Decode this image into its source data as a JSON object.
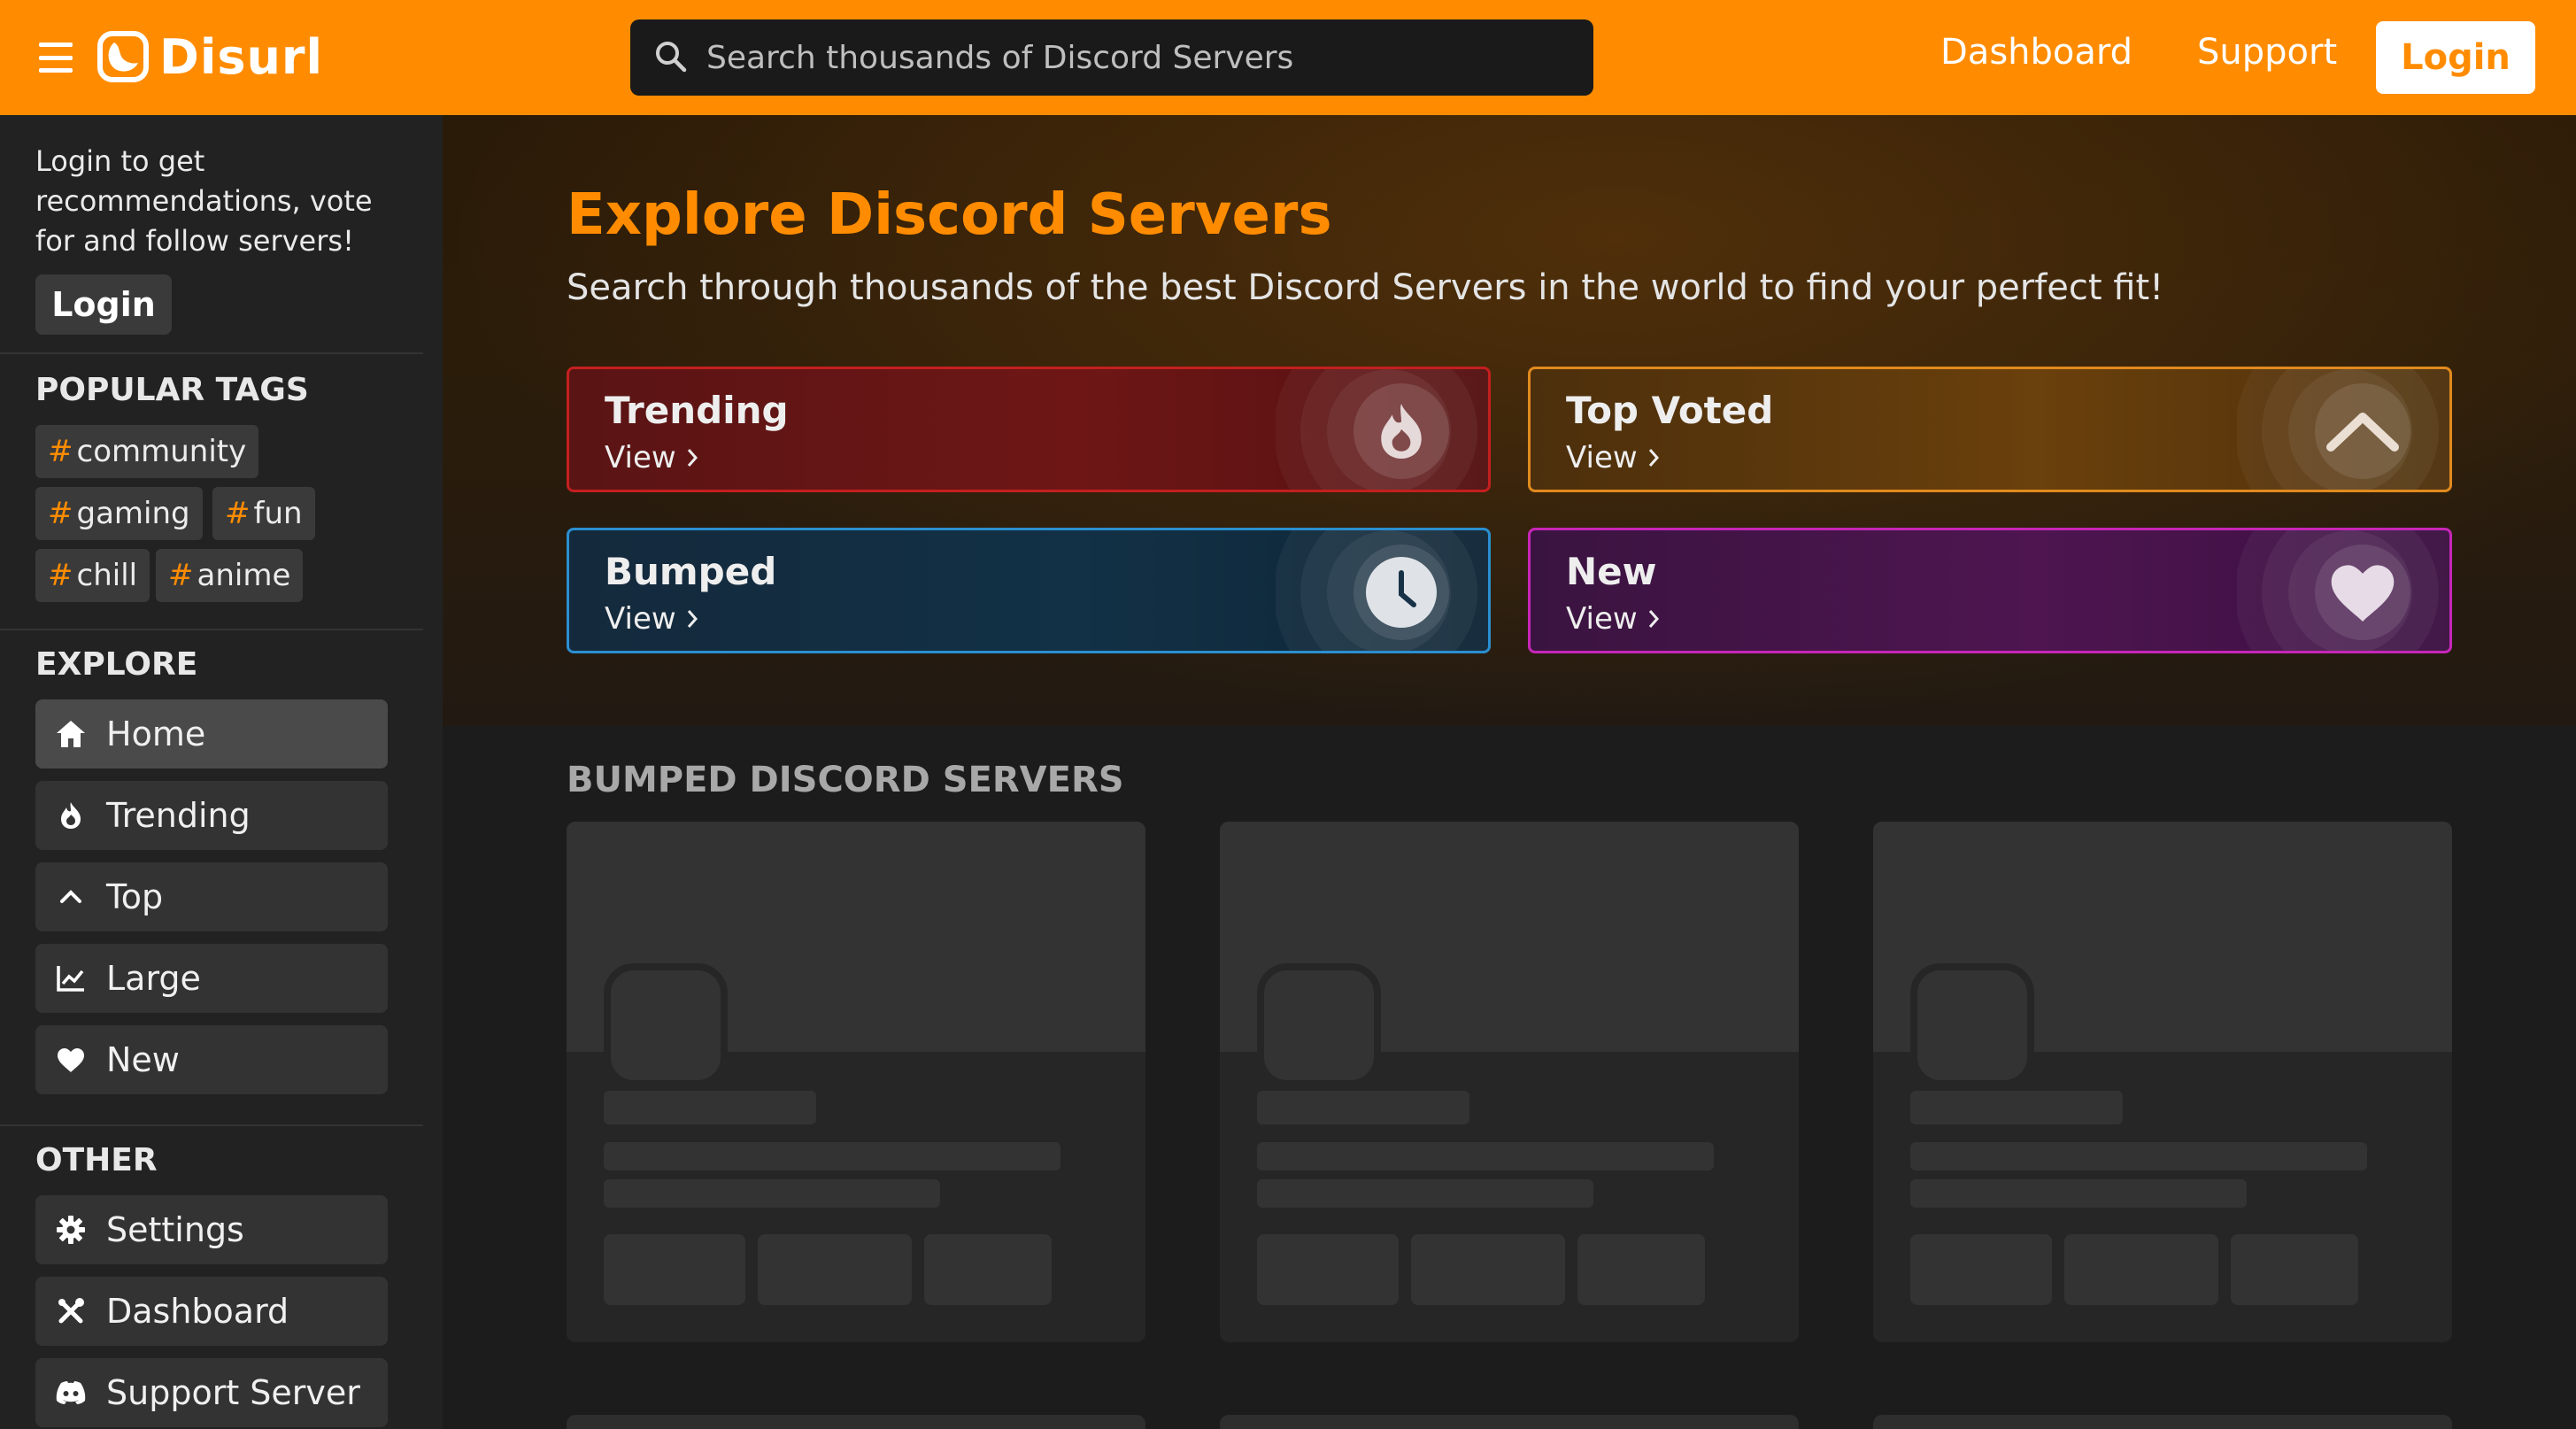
{
  "header": {
    "brand": "Disurl",
    "search_placeholder": "Search thousands of Discord Servers",
    "nav": [
      "Dashboard",
      "Support"
    ],
    "login_label": "Login",
    "accent_color": "#ff8c00"
  },
  "sidebar": {
    "login_prompt": "Login to get recommendations, vote for and follow servers!",
    "login_label": "Login",
    "popular_tags_heading": "POPULAR TAGS",
    "tags": [
      "community",
      "gaming",
      "fun",
      "chill",
      "anime"
    ],
    "tag_prefix": "#",
    "explore_heading": "EXPLORE",
    "explore_items": [
      {
        "label": "Home",
        "icon": "home-icon",
        "active": true
      },
      {
        "label": "Trending",
        "icon": "flame-icon"
      },
      {
        "label": "Top",
        "icon": "chevron-up-icon"
      },
      {
        "label": "Large",
        "icon": "line-chart-icon"
      },
      {
        "label": "New",
        "icon": "heart-icon"
      }
    ],
    "other_heading": "OTHER",
    "other_items": [
      {
        "label": "Settings",
        "icon": "gear-icon"
      },
      {
        "label": "Dashboard",
        "icon": "tools-icon"
      },
      {
        "label": "Support Server",
        "icon": "discord-icon"
      }
    ]
  },
  "hero": {
    "title": "Explore Discord Servers",
    "subtitle": "Search through thousands of the best Discord Servers in the world to find your perfect fit!",
    "categories": [
      {
        "name": "Trending",
        "view_label": "View",
        "icon": "flame-icon",
        "color": "#c41f1f"
      },
      {
        "name": "Top Voted",
        "view_label": "View",
        "icon": "chevron-up-icon",
        "color": "#e08a1e"
      },
      {
        "name": "Bumped",
        "view_label": "View",
        "icon": "clock-icon",
        "color": "#2a8fd0"
      },
      {
        "name": "New",
        "view_label": "View",
        "icon": "heart-icon",
        "color": "#c726b8"
      }
    ]
  },
  "bumped": {
    "heading": "BUMPED DISCORD SERVERS"
  }
}
